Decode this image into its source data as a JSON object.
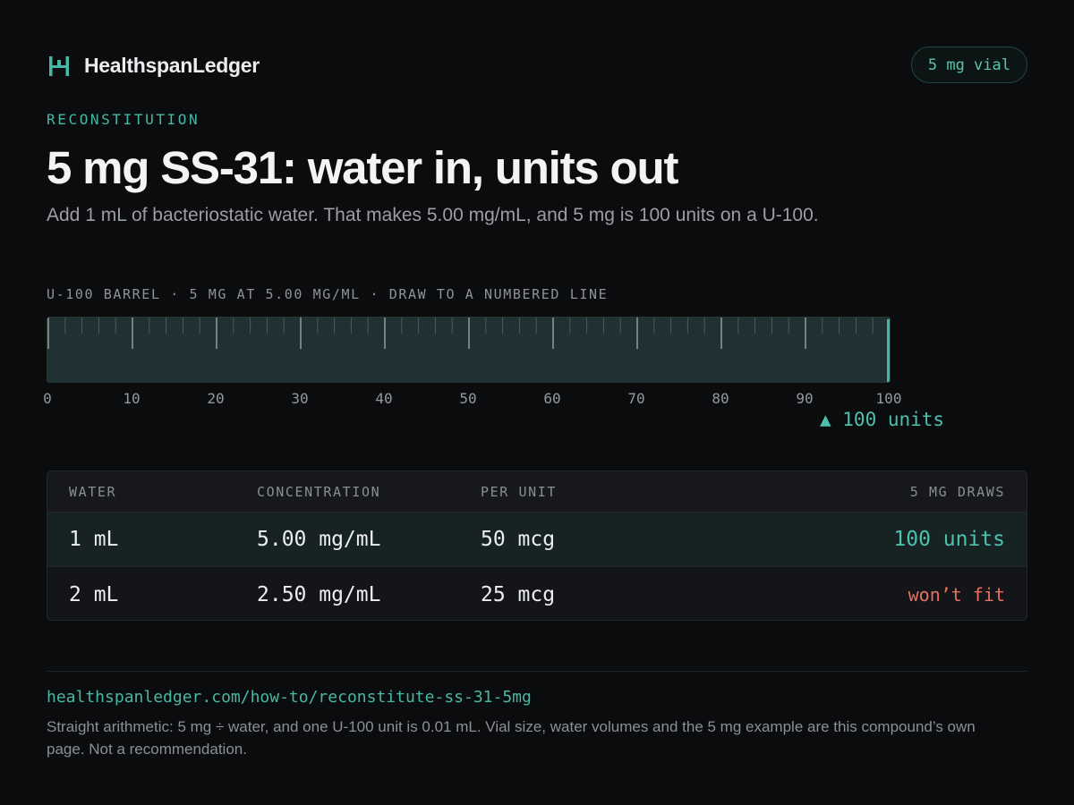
{
  "header": {
    "brand_name": "HealthspanLedger",
    "brand_icon": "ledger-h-logo-icon",
    "vial_badge": "5 mg vial"
  },
  "hero": {
    "eyebrow": "RECONSTITUTION",
    "title": "5 mg SS-31: water in, units out",
    "subtitle": "Add 1 mL of bacteriostatic water. That makes 5.00 mg/mL, and 5 mg is 100 units on a U-100."
  },
  "barrel": {
    "caption": "U-100 BARREL · 5 MG AT 5.00 MG/ML · DRAW TO A NUMBERED LINE",
    "tick_labels": [
      "0",
      "10",
      "20",
      "30",
      "40",
      "50",
      "60",
      "70",
      "80",
      "90",
      "100"
    ],
    "scale_max_units": 100,
    "draw_units": 100,
    "marker_label": "▲ 100 units"
  },
  "table": {
    "headers": {
      "water": "WATER",
      "concentration": "CONCENTRATION",
      "per_unit": "PER UNIT",
      "draws": "5 MG DRAWS"
    },
    "rows": [
      {
        "water": "1 mL",
        "concentration": "5.00 mg/mL",
        "per_unit": "50 mcg",
        "draws": "100 units",
        "fits": true
      },
      {
        "water": "2 mL",
        "concentration": "2.50 mg/mL",
        "per_unit": "25 mcg",
        "draws": "won’t fit",
        "fits": false
      }
    ]
  },
  "footer": {
    "url": "healthspanledger.com/how-to/reconstitute-ss-31-5mg",
    "note": "Straight arithmetic: 5 mg ÷ water, and one U-100 unit is 0.01 mL. Vial size, water volumes and the 5 mg example are this compound’s own page. Not a recommendation."
  },
  "colors": {
    "accent": "#47b8a5",
    "warning": "#e7705f",
    "barrel_fill": "#1f3132",
    "background": "#0b0c0e"
  }
}
